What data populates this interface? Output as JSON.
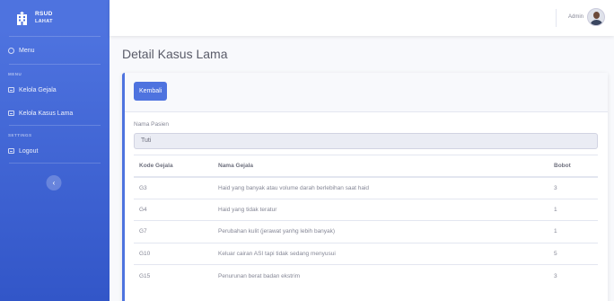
{
  "brand": {
    "title": "RSUD",
    "subtitle": "LAHAT",
    "icon": "hospital-icon"
  },
  "sidebar": {
    "menu_label": "Menu",
    "section_menu": "MENU",
    "items_menu": [
      {
        "label": "Kelola Gejala",
        "icon": "table-icon"
      },
      {
        "label": "Kelola Kasus Lama",
        "icon": "table-icon"
      }
    ],
    "section_settings": "SETTINGS",
    "logout_label": "Logout",
    "toggle_symbol": "‹"
  },
  "topbar": {
    "user_name": "Admin"
  },
  "page": {
    "title": "Detail Kasus Lama"
  },
  "card": {
    "back_button": "Kembali",
    "patient_label": "Nama Pasien",
    "patient_value": "Tuti"
  },
  "table": {
    "headers": [
      "Kode Gejala",
      "Nama Gejala",
      "Bobot"
    ],
    "rows": [
      [
        "G3",
        "Haid yang banyak atau volume darah berlebihan saat haid",
        "3"
      ],
      [
        "G4",
        "Haid yang tidak teratur",
        "1"
      ],
      [
        "G7",
        "Perubahan kulit (jerawat yanhg lebih banyak)",
        "1"
      ],
      [
        "G10",
        "Keluar cairan ASI tapi tidak sedang menyusui",
        "5"
      ],
      [
        "G15",
        "Penurunan berat badan ekstrim",
        "3"
      ]
    ]
  },
  "colors": {
    "primary": "#4e73df",
    "background": "#f8f9fc",
    "text": "#858796"
  }
}
